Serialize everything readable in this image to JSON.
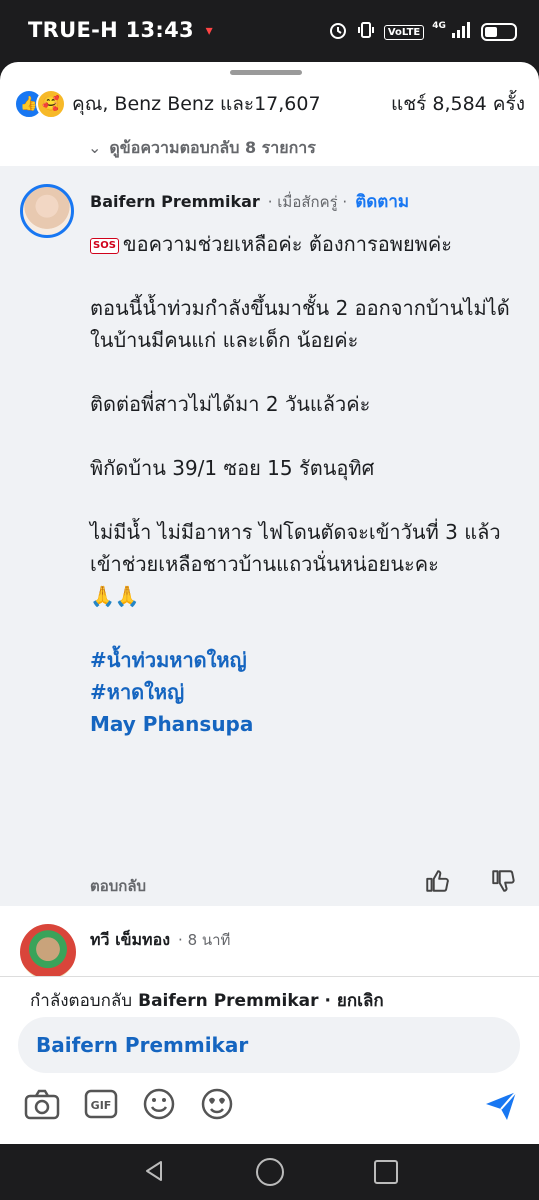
{
  "status_bar": {
    "carrier": "TRUE-H",
    "time": "13:43",
    "network_badge": "VoLTE",
    "network_type": "4G"
  },
  "reactions": {
    "reactors": "คุณ, Benz Benz และ17,607",
    "shares": "แชร์ 8,584 ครั้ง"
  },
  "view_replies": "ดูข้อความตอบกลับ 8 รายการ",
  "comment": {
    "author": "Baifern Premmikar",
    "time": "· เมื่อสักครู่ ·",
    "follow": "ติดตาม",
    "sos_badge": "SOS",
    "line1": "ขอความช่วยเหลือค่ะ ต้องการอพยพค่ะ",
    "line2": "ตอนนี้น้ำท่วมกำลังขึ้นมาชั้น 2 ออกจากบ้านไม่ได้",
    "line3": "ในบ้านมีคนแก่ และเด็ก น้อยค่ะ",
    "line4": "ติดต่อพี่สาวไม่ได้มา 2 วันแล้วค่ะ",
    "line5": "พิกัดบ้าน 39/1 ซอย 15 รัตนอุทิศ",
    "line6": "ไม่มีน้ำ ไม่มีอาหาร ไฟโดนตัดจะเข้าวันที่ 3 แล้ว",
    "line7": "เข้าช่วยเหลือชาวบ้านแถวนั่นหน่อยนะคะ",
    "emoji": "🙏🙏",
    "hashtag1": "#น้ำท่วมหาดใหญ่",
    "hashtag2": "#หาดใหญ่",
    "mention": "May Phansupa",
    "reply_label": "ตอบกลับ"
  },
  "comment2": {
    "author": "ทวี เข็มทอง",
    "time": "· 8 นาที"
  },
  "reply_bar": {
    "replying_to_prefix": "กำลังตอบกลับ",
    "replying_to_name": "Baifern Premmikar",
    "cancel": "· ยกเลิก",
    "input_value": "Baifern Premmikar"
  },
  "colors": {
    "accent": "#1877f2",
    "hashtag": "#1565c0",
    "card_bg": "#f0f2f5"
  },
  "icons": [
    "camera-icon",
    "gif-icon",
    "emoji-icon",
    "sticker-icon",
    "send-icon"
  ]
}
